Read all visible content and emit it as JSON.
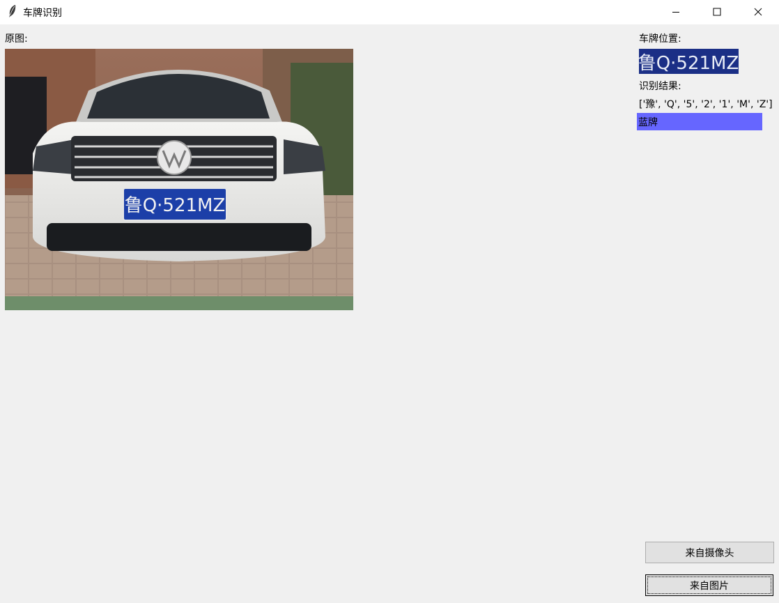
{
  "window": {
    "title": "车牌识别",
    "icon": "feather-icon",
    "controls": [
      "minimize-icon",
      "maximize-icon",
      "close-icon"
    ]
  },
  "main": {
    "original_label": "原图:",
    "image_plate_text": "鲁Q·521MZ"
  },
  "sidebar": {
    "plate_position_label": "车牌位置:",
    "plate_crop_text": "鲁Q·521MZ",
    "result_label": "识别结果:",
    "result_text": "['豫', 'Q', '5', '2', '1', 'M', 'Z']",
    "plate_color_text": "蓝牌",
    "plate_color_bg": "#6666ff"
  },
  "buttons": {
    "from_camera": "来自摄像头",
    "from_image": "来自图片"
  },
  "colors": {
    "titlebar_bg": "#ffffff",
    "window_bg": "#f0f0f0",
    "plate_blue": "#1c3fa8",
    "button_bg": "#e1e1e1"
  }
}
